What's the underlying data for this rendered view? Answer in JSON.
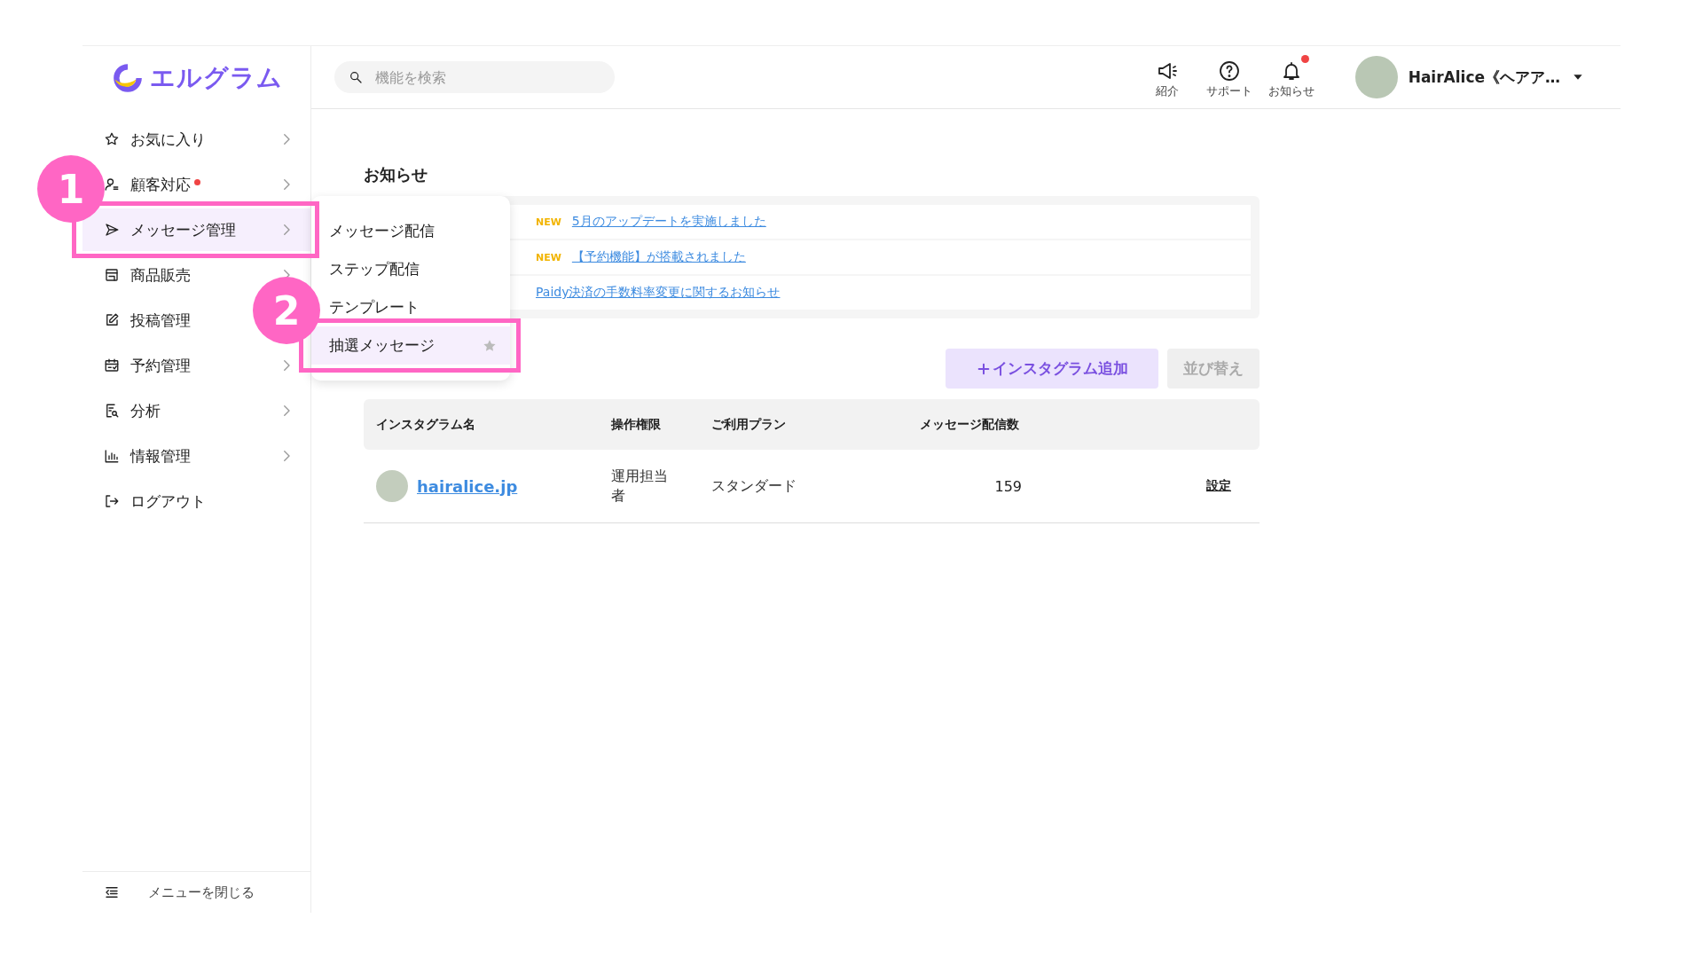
{
  "app": {
    "logo": "エルグラム"
  },
  "search": {
    "placeholder": "機能を検索"
  },
  "header_actions": [
    {
      "label": "紹介",
      "kind": "megaphone",
      "badge": false
    },
    {
      "label": "サポート",
      "kind": "help",
      "badge": false
    },
    {
      "label": "お知らせ",
      "kind": "bell",
      "badge": true
    }
  ],
  "account": {
    "name": "HairAlice《ヘアア…"
  },
  "sidebar": {
    "items": [
      {
        "label": "お気に入り",
        "kind": "star",
        "selected": false,
        "badge": false,
        "arrow": true
      },
      {
        "label": "顧客対応",
        "kind": "person",
        "selected": false,
        "badge": true,
        "arrow": true
      },
      {
        "label": "メッセージ管理",
        "kind": "send",
        "selected": true,
        "badge": false,
        "arrow": true
      },
      {
        "label": "商品販売",
        "kind": "store",
        "selected": false,
        "badge": false,
        "arrow": true
      },
      {
        "label": "投稿管理",
        "kind": "edit",
        "selected": false,
        "badge": false,
        "arrow": false
      },
      {
        "label": "予約管理",
        "kind": "calendar",
        "selected": false,
        "badge": false,
        "arrow": true
      },
      {
        "label": "分析",
        "kind": "report",
        "selected": false,
        "badge": false,
        "arrow": true
      },
      {
        "label": "情報管理",
        "kind": "chart",
        "selected": false,
        "badge": false,
        "arrow": true
      },
      {
        "label": "ログアウト",
        "kind": "logout",
        "selected": false,
        "badge": false,
        "arrow": false
      }
    ],
    "collapse": "メニューを閉じる"
  },
  "submenu": {
    "items": [
      {
        "label": "メッセージ配信",
        "selected": false,
        "star": false
      },
      {
        "label": "ステップ配信",
        "selected": false,
        "star": false
      },
      {
        "label": "テンプレート",
        "selected": false,
        "star": false
      },
      {
        "label": "抽選メッセージ",
        "selected": true,
        "star": true
      }
    ]
  },
  "notices": {
    "title": "お知らせ",
    "items": [
      {
        "badge": "NEW",
        "text": "5月のアップデートを実施しました"
      },
      {
        "badge": "NEW",
        "text": "【予約機能】が搭載されました"
      },
      {
        "text": "Paidy決済の手数料率変更に関するお知らせ"
      }
    ]
  },
  "buttons": [
    {
      "label": "インスタグラム追加",
      "kind": "primary"
    },
    {
      "label": "並び替え",
      "kind": "secondary"
    }
  ],
  "table": {
    "columns": [
      "インスタグラム名",
      "操作権限",
      "ご利用プラン",
      "メッセージ配信数"
    ],
    "rows": [
      {
        "name": "hairalice.jp",
        "role": "運用担当者",
        "plan": "スタンダード",
        "count": "159",
        "action": "設定"
      }
    ]
  },
  "annotations": [
    {
      "label": "1"
    },
    {
      "label": "2"
    }
  ]
}
